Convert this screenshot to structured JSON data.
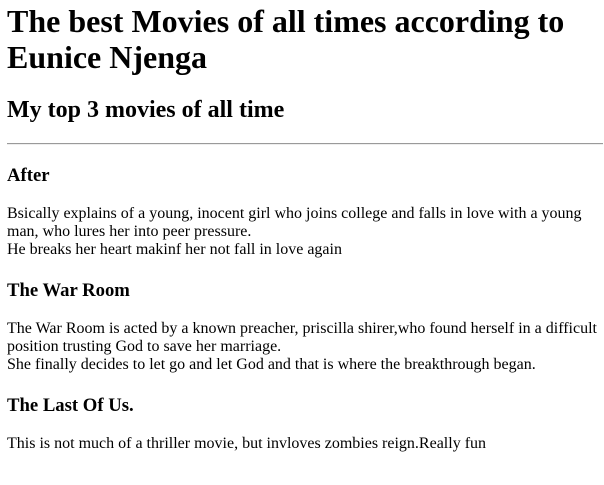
{
  "page": {
    "title": "The best Movies of all times according to Eunice Njenga",
    "subtitle": "My top 3 movies of all time"
  },
  "movies": [
    {
      "title": "After",
      "line1": "Bsically explains of a young, inocent girl who joins college and falls in love with a young man, who lures her into peer pressure.",
      "line2": "He breaks her heart makinf her not fall in love again"
    },
    {
      "title": "The War Room",
      "line1": "The War Room is acted by a known preacher, priscilla shirer,who found herself in a difficult position trusting God to save her marriage.",
      "line2": "She finally decides to let go and let God and that is where the breakthrough began."
    },
    {
      "title": "The Last Of Us.",
      "line1": "This is not much of a thriller movie, but invloves zombies reign.Really fun",
      "line2": ""
    }
  ]
}
